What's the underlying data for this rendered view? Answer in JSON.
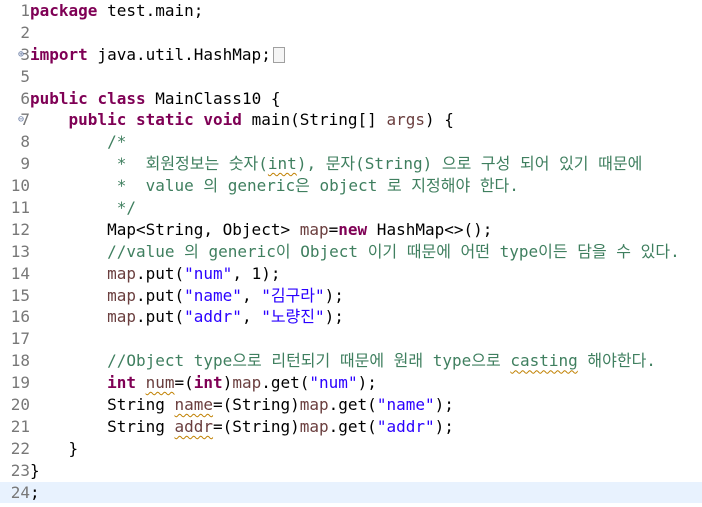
{
  "editor": {
    "lines": [
      {
        "n": "1",
        "fold": "",
        "segs": [
          {
            "c": "kw",
            "t": "package"
          },
          {
            "c": "",
            "t": " test.main;"
          }
        ]
      },
      {
        "n": "2",
        "fold": "",
        "segs": []
      },
      {
        "n": "3",
        "fold": "⊕",
        "segs": [
          {
            "c": "kw",
            "t": "import"
          },
          {
            "c": "",
            "t": " java.util.HashMap;"
          },
          {
            "c": "box",
            "t": ""
          }
        ]
      },
      {
        "n": "5",
        "fold": "",
        "segs": []
      },
      {
        "n": "6",
        "fold": "",
        "segs": [
          {
            "c": "kw",
            "t": "public"
          },
          {
            "c": "",
            "t": " "
          },
          {
            "c": "kw",
            "t": "class"
          },
          {
            "c": "",
            "t": " MainClass10 {"
          }
        ]
      },
      {
        "n": "7",
        "fold": "⊖",
        "segs": [
          {
            "c": "",
            "t": "    "
          },
          {
            "c": "kw",
            "t": "public"
          },
          {
            "c": "",
            "t": " "
          },
          {
            "c": "kw",
            "t": "static"
          },
          {
            "c": "",
            "t": " "
          },
          {
            "c": "kw",
            "t": "void"
          },
          {
            "c": "",
            "t": " main(String[] "
          },
          {
            "c": "fld",
            "t": "args"
          },
          {
            "c": "",
            "t": ") {"
          }
        ]
      },
      {
        "n": "8",
        "fold": "",
        "segs": [
          {
            "c": "cm",
            "t": "        /*"
          }
        ]
      },
      {
        "n": "9",
        "fold": "",
        "segs": [
          {
            "c": "cm",
            "t": "         *  회원정보는 숫자("
          },
          {
            "c": "cmsq",
            "t": "int"
          },
          {
            "c": "cm",
            "t": "), 문자(String) 으로 구성 되어 있기 때문에"
          }
        ]
      },
      {
        "n": "10",
        "fold": "",
        "segs": [
          {
            "c": "cm",
            "t": "         *  value 의 generic은 object 로 지정해야 한다."
          }
        ]
      },
      {
        "n": "11",
        "fold": "",
        "segs": [
          {
            "c": "cm",
            "t": "         */"
          }
        ]
      },
      {
        "n": "12",
        "fold": "",
        "segs": [
          {
            "c": "",
            "t": "        Map<String, Object> "
          },
          {
            "c": "fld",
            "t": "map"
          },
          {
            "c": "",
            "t": "="
          },
          {
            "c": "kw",
            "t": "new"
          },
          {
            "c": "",
            "t": " HashMap<>();"
          }
        ]
      },
      {
        "n": "13",
        "fold": "",
        "segs": [
          {
            "c": "cm",
            "t": "        //value 의 generic이 Object 이기 때문에 어떤 type이든 담을 수 있다."
          }
        ]
      },
      {
        "n": "14",
        "fold": "",
        "segs": [
          {
            "c": "",
            "t": "        "
          },
          {
            "c": "fld",
            "t": "map"
          },
          {
            "c": "",
            "t": ".put("
          },
          {
            "c": "str",
            "t": "\"num\""
          },
          {
            "c": "",
            "t": ", 1);"
          }
        ]
      },
      {
        "n": "15",
        "fold": "",
        "segs": [
          {
            "c": "",
            "t": "        "
          },
          {
            "c": "fld",
            "t": "map"
          },
          {
            "c": "",
            "t": ".put("
          },
          {
            "c": "str",
            "t": "\"name\""
          },
          {
            "c": "",
            "t": ", "
          },
          {
            "c": "str",
            "t": "\"김구라\""
          },
          {
            "c": "",
            "t": ");"
          }
        ]
      },
      {
        "n": "16",
        "fold": "",
        "segs": [
          {
            "c": "",
            "t": "        "
          },
          {
            "c": "fld",
            "t": "map"
          },
          {
            "c": "",
            "t": ".put("
          },
          {
            "c": "str",
            "t": "\"addr\""
          },
          {
            "c": "",
            "t": ", "
          },
          {
            "c": "str",
            "t": "\"노량진\""
          },
          {
            "c": "",
            "t": ");"
          }
        ]
      },
      {
        "n": "17",
        "fold": "",
        "segs": []
      },
      {
        "n": "18",
        "fold": "",
        "segs": [
          {
            "c": "cm",
            "t": "        //Object type으로 리턴되기 때문에 원래 type으로 "
          },
          {
            "c": "cmsq",
            "t": "casting"
          },
          {
            "c": "cm",
            "t": " 해야한다."
          }
        ]
      },
      {
        "n": "19",
        "fold": "",
        "segs": [
          {
            "c": "",
            "t": "        "
          },
          {
            "c": "kw",
            "t": "int"
          },
          {
            "c": "",
            "t": " "
          },
          {
            "c": "fldsq",
            "t": "num"
          },
          {
            "c": "",
            "t": "=("
          },
          {
            "c": "kw",
            "t": "int"
          },
          {
            "c": "",
            "t": ")"
          },
          {
            "c": "fld",
            "t": "map"
          },
          {
            "c": "",
            "t": ".get("
          },
          {
            "c": "str",
            "t": "\"num\""
          },
          {
            "c": "",
            "t": ");"
          }
        ]
      },
      {
        "n": "20",
        "fold": "",
        "segs": [
          {
            "c": "",
            "t": "        String "
          },
          {
            "c": "fldsq",
            "t": "name"
          },
          {
            "c": "",
            "t": "=(String)"
          },
          {
            "c": "fld",
            "t": "map"
          },
          {
            "c": "",
            "t": ".get("
          },
          {
            "c": "str",
            "t": "\"name\""
          },
          {
            "c": "",
            "t": ");"
          }
        ]
      },
      {
        "n": "21",
        "fold": "",
        "segs": [
          {
            "c": "",
            "t": "        String "
          },
          {
            "c": "fldsq",
            "t": "addr"
          },
          {
            "c": "",
            "t": "=(String)"
          },
          {
            "c": "fld",
            "t": "map"
          },
          {
            "c": "",
            "t": ".get("
          },
          {
            "c": "str",
            "t": "\"addr\""
          },
          {
            "c": "",
            "t": ");"
          }
        ]
      },
      {
        "n": "22",
        "fold": "",
        "segs": [
          {
            "c": "",
            "t": "    }"
          }
        ]
      },
      {
        "n": "23",
        "fold": "",
        "segs": [
          {
            "c": "",
            "t": "}"
          }
        ]
      },
      {
        "n": "24",
        "fold": "",
        "segs": [
          {
            "c": "",
            "t": ";"
          }
        ],
        "current": true
      }
    ],
    "colors": {
      "keyword": "#7f0055",
      "comment": "#3f7f5f",
      "string": "#2a00ff",
      "variable": "#6a3e3e",
      "line_number": "#787878",
      "current_line": "#e8f2fe"
    }
  }
}
